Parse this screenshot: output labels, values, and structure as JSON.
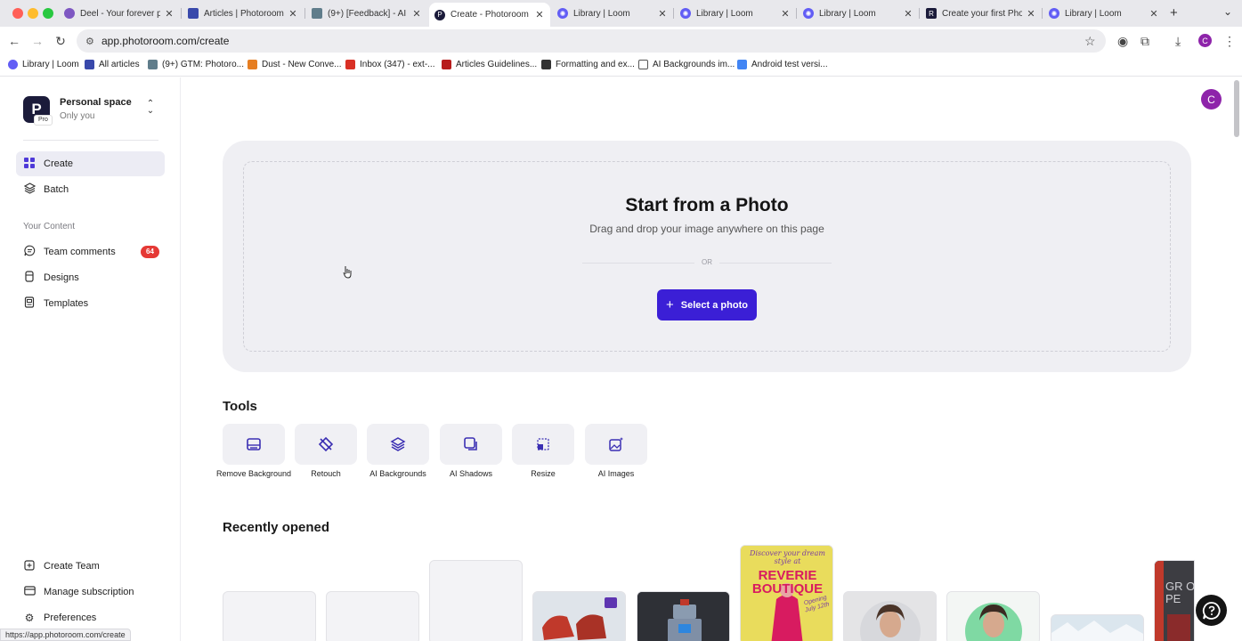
{
  "browser": {
    "tabs": [
      {
        "title": "Deel - Your forever p",
        "fav_color": "#7e57c2",
        "active": false
      },
      {
        "title": "Articles | Photoroom",
        "fav_color": "#3949ab",
        "active": false
      },
      {
        "title": "(9+) [Feedback] - AI",
        "fav_color": "#607d8b",
        "active": false
      },
      {
        "title": "Create - Photoroom",
        "fav_color": "#1b1b3a",
        "active": true
      },
      {
        "title": "Library | Loom",
        "fav_color": "#625df5",
        "active": false
      },
      {
        "title": "Library | Loom",
        "fav_color": "#625df5",
        "active": false
      },
      {
        "title": "Library | Loom",
        "fav_color": "#625df5",
        "active": false
      },
      {
        "title": "Create your first Pho",
        "fav_color": "#1b1b3a",
        "active": false
      },
      {
        "title": "Library | Loom",
        "fav_color": "#625df5",
        "active": false
      }
    ],
    "url": "app.photoroom.com/create",
    "profile_initial": "C",
    "bookmarks": [
      {
        "label": "Library | Loom",
        "color": "#625df5"
      },
      {
        "label": "All articles",
        "color": "#3949ab"
      },
      {
        "label": "(9+) GTM: Photoro...",
        "color": "#607d8b"
      },
      {
        "label": "Dust - New Conve...",
        "color": "#e67e22"
      },
      {
        "label": "Inbox (347) - ext-...",
        "color": "#d93025"
      },
      {
        "label": "Articles Guidelines...",
        "color": "#b71c1c"
      },
      {
        "label": "Formatting and ex...",
        "color": "#333333"
      },
      {
        "label": "AI Backgrounds im...",
        "color": "#555555"
      },
      {
        "label": "Android test versi...",
        "color": "#4285f4"
      }
    ]
  },
  "workspace": {
    "logo_letter": "P",
    "badge": "Pro",
    "name": "Personal space",
    "subtitle": "Only you"
  },
  "sidebar": {
    "primary": [
      {
        "label": "Create",
        "icon": "grid-icon",
        "active": true
      },
      {
        "label": "Batch",
        "icon": "layers-icon",
        "active": false
      }
    ],
    "section_label": "Your Content",
    "content": [
      {
        "label": "Team comments",
        "icon": "comment-icon",
        "badge": "64"
      },
      {
        "label": "Designs",
        "icon": "designs-icon"
      },
      {
        "label": "Templates",
        "icon": "templates-icon"
      }
    ],
    "bottom": [
      {
        "label": "Create Team",
        "icon": "team-icon"
      },
      {
        "label": "Manage subscription",
        "icon": "card-icon"
      },
      {
        "label": "Preferences",
        "icon": "gear-icon"
      }
    ]
  },
  "header": {
    "avatar_initial": "C",
    "avatar_color": "#8e24aa"
  },
  "hero": {
    "title": "Start from a Photo",
    "subtitle": "Drag and drop your image anywhere on this page",
    "or_text": "OR",
    "button_label": "Select a photo",
    "button_color": "#3b1fd6"
  },
  "tools": {
    "heading": "Tools",
    "items": [
      {
        "label": "Remove Background",
        "icon": "remove-background-icon"
      },
      {
        "label": "Retouch",
        "icon": "retouch-icon"
      },
      {
        "label": "AI Backgrounds",
        "icon": "ai-backgrounds-icon"
      },
      {
        "label": "AI Shadows",
        "icon": "ai-shadows-icon"
      },
      {
        "label": "Resize",
        "icon": "resize-icon"
      },
      {
        "label": "AI Images",
        "icon": "ai-images-icon"
      }
    ]
  },
  "recent": {
    "heading": "Recently opened",
    "items": [
      {
        "kind": "blank"
      },
      {
        "kind": "blank"
      },
      {
        "kind": "blank"
      },
      {
        "kind": "photo-boots"
      },
      {
        "kind": "photo-robot"
      },
      {
        "kind": "poster",
        "text_top": "Discover your dream style at",
        "text_main": "REVERIE BOUTIQUE",
        "text_badge": "Opening July 12th"
      },
      {
        "kind": "portrait-grey"
      },
      {
        "kind": "portrait-green"
      },
      {
        "kind": "photo-snow"
      },
      {
        "kind": "poster-grand",
        "text_main": "GR OPE"
      }
    ]
  },
  "status_bar": {
    "url": "https://app.photoroom.com/create"
  }
}
